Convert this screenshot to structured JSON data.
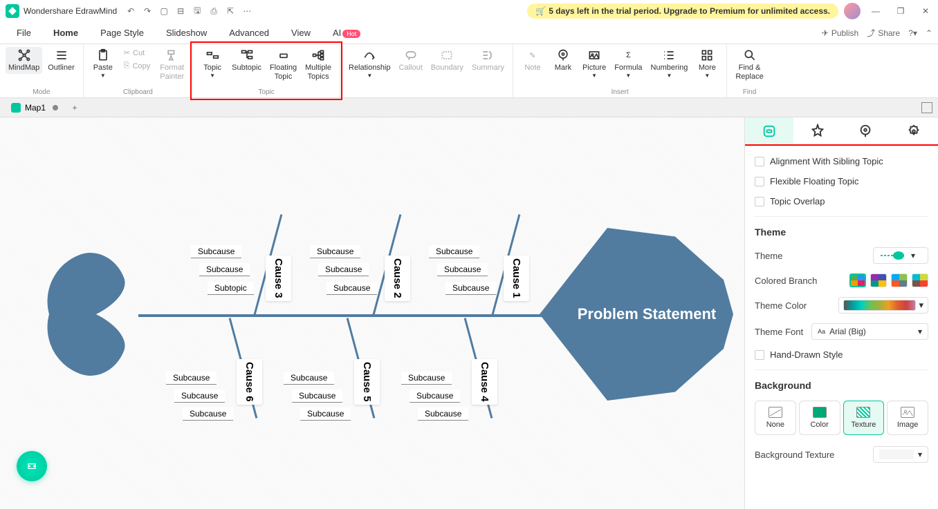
{
  "app_title": "Wondershare EdrawMind",
  "trial_message": "5 days left in the trial period. Upgrade to Premium for unlimited access.",
  "menubar": {
    "items": [
      "File",
      "Home",
      "Page Style",
      "Slideshow",
      "Advanced",
      "View"
    ],
    "ai_label": "AI",
    "ai_badge": "Hot",
    "publish": "Publish",
    "share": "Share"
  },
  "ribbon": {
    "mode": {
      "mindmap": "MindMap",
      "outliner": "Outliner",
      "label": "Mode"
    },
    "clipboard": {
      "paste": "Paste",
      "cut": "Cut",
      "copy": "Copy",
      "format_painter": "Format\nPainter",
      "label": "Clipboard"
    },
    "topic": {
      "topic": "Topic",
      "subtopic": "Subtopic",
      "floating": "Floating\nTopic",
      "multiple": "Multiple\nTopics",
      "label": "Topic"
    },
    "relationship": "Relationship",
    "callout": "Callout",
    "boundary": "Boundary",
    "summary": "Summary",
    "insert": {
      "note": "Note",
      "mark": "Mark",
      "picture": "Picture",
      "formula": "Formula",
      "numbering": "Numbering",
      "more": "More",
      "label": "Insert"
    },
    "find": {
      "find_replace": "Find &\nReplace",
      "label": "Find"
    }
  },
  "document": {
    "tab_name": "Map1"
  },
  "fishbone": {
    "head": "Problem Statement",
    "causes": [
      {
        "name": "Cause 1",
        "subs": [
          "Subcause",
          "Subcause",
          "Subcause"
        ]
      },
      {
        "name": "Cause 2",
        "subs": [
          "Subcause",
          "Subcause",
          "Subcause"
        ]
      },
      {
        "name": "Cause 3",
        "subs": [
          "Subcause",
          "Subcause",
          "Subtopic"
        ]
      },
      {
        "name": "Cause 4",
        "subs": [
          "Subcause",
          "Subcause",
          "Subcause"
        ]
      },
      {
        "name": "Cause 5",
        "subs": [
          "Subcause",
          "Subcause",
          "Subcause"
        ]
      },
      {
        "name": "Cause 6",
        "subs": [
          "Subcause",
          "Subcause",
          "Subcause"
        ]
      }
    ]
  },
  "panel": {
    "alignment": "Alignment With Sibling Topic",
    "flexible": "Flexible Floating Topic",
    "overlap": "Topic Overlap",
    "theme_section": "Theme",
    "theme_label": "Theme",
    "colored_branch": "Colored Branch",
    "theme_color": "Theme Color",
    "theme_font": "Theme Font",
    "theme_font_value": "Arial (Big)",
    "hand_drawn": "Hand-Drawn Style",
    "background_section": "Background",
    "bg_none": "None",
    "bg_color": "Color",
    "bg_texture": "Texture",
    "bg_image": "Image",
    "bg_texture_label": "Background Texture"
  }
}
